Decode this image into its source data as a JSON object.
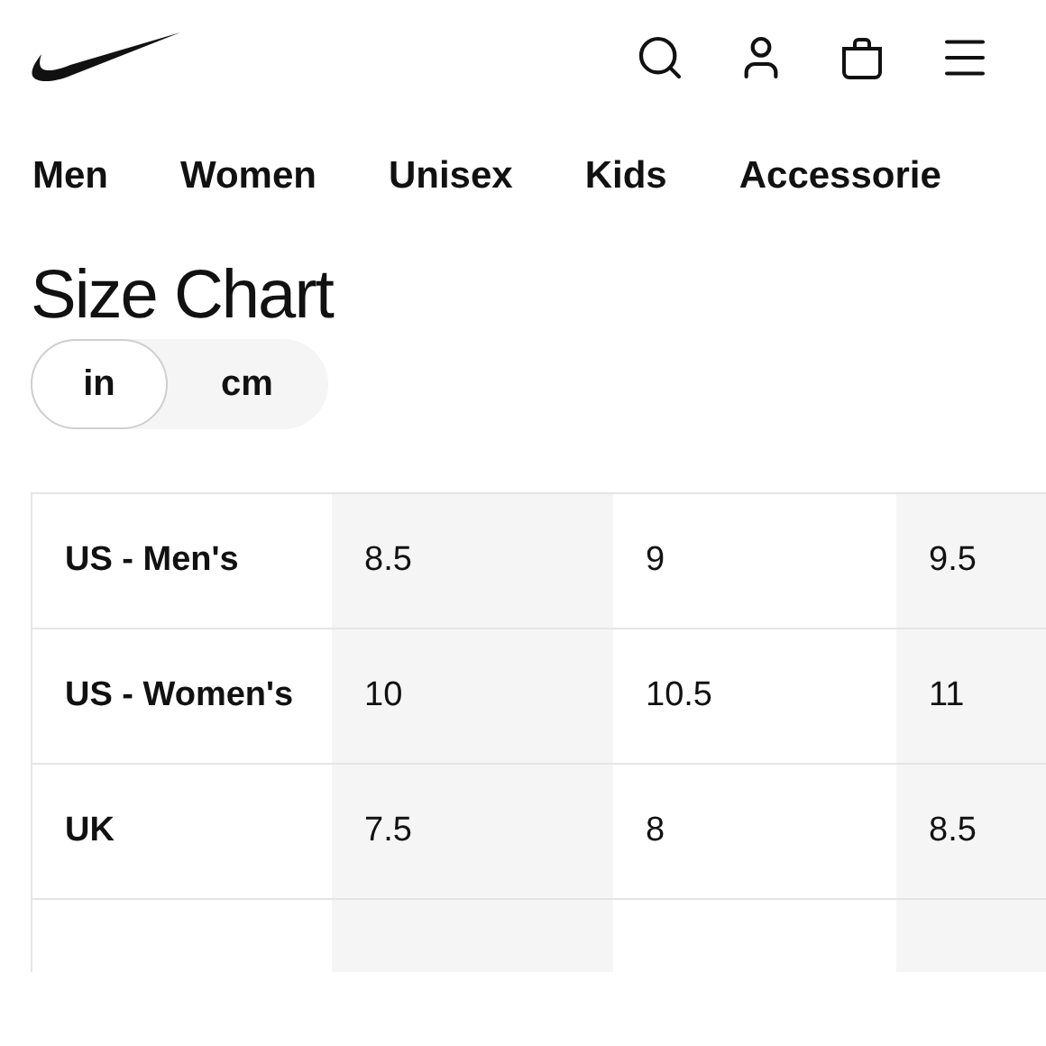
{
  "nav": [
    {
      "label": "Men"
    },
    {
      "label": "Women"
    },
    {
      "label": "Unisex"
    },
    {
      "label": "Kids"
    },
    {
      "label": "Accessorie"
    }
  ],
  "title": "Size Chart",
  "units": [
    {
      "label": "in",
      "selected": true
    },
    {
      "label": "cm",
      "selected": false
    }
  ],
  "table": {
    "rows": [
      {
        "label": "US - Men's",
        "cells": [
          "8.5",
          "9",
          "9.5"
        ]
      },
      {
        "label": "US - Women's",
        "cells": [
          "10",
          "10.5",
          "11"
        ]
      },
      {
        "label": "UK",
        "cells": [
          "7.5",
          "8",
          "8.5"
        ]
      }
    ]
  }
}
